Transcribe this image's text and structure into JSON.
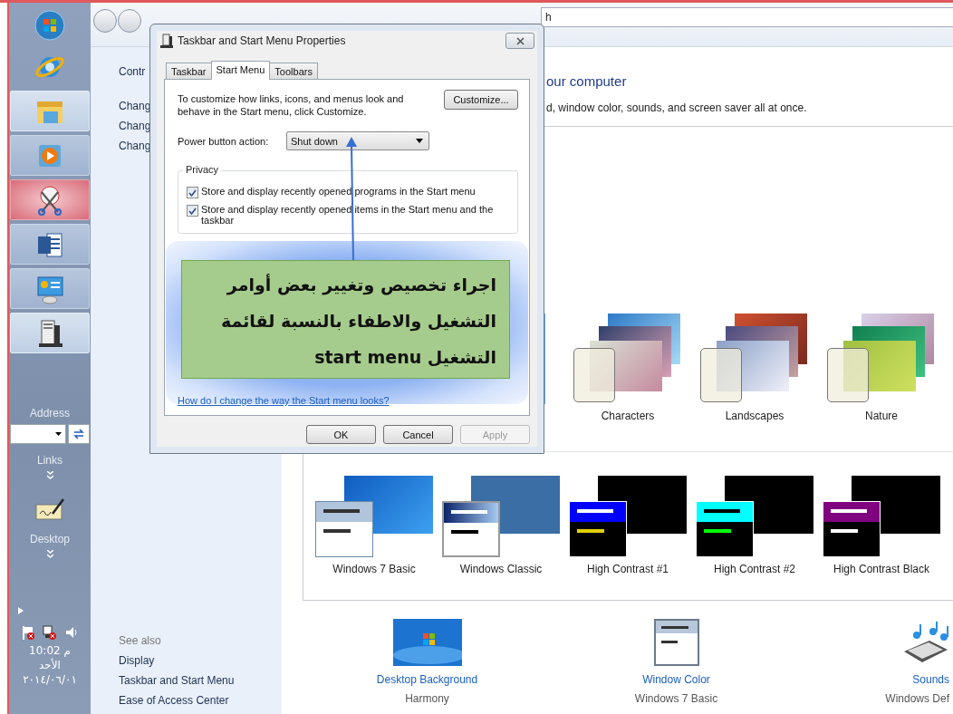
{
  "taskbar": {
    "buttons": [
      {
        "kind": "browser",
        "running": false,
        "highlighted": false,
        "attention": false
      },
      {
        "kind": "folder",
        "running": true,
        "highlighted": true,
        "attention": false
      },
      {
        "kind": "media",
        "running": true,
        "highlighted": false,
        "attention": false
      },
      {
        "kind": "scissors",
        "running": true,
        "highlighted": false,
        "attention": true
      },
      {
        "kind": "document",
        "running": true,
        "highlighted": false,
        "attention": false
      },
      {
        "kind": "presentation",
        "running": true,
        "highlighted": false,
        "attention": false
      },
      {
        "kind": "computer",
        "running": true,
        "highlighted": true,
        "attention": false
      }
    ],
    "address_toolbar": {
      "label": "Address"
    },
    "links_toolbar": {
      "label": "Links"
    },
    "desktop_toolbar": {
      "label": "Desktop"
    },
    "clock": {
      "time": "10:02 م",
      "day": "الأحد",
      "date": "٢٠١٤/٠٦/٠١"
    }
  },
  "control_panel": {
    "address_text": "h",
    "sidebar": {
      "title": "Contr",
      "links": [
        "Chang",
        "Chang",
        "Chang"
      ],
      "see_also": {
        "title": "See also",
        "links": [
          "Display",
          "Taskbar and Start Menu",
          "Ease of Access Center"
        ]
      }
    },
    "heading": "our computer",
    "description": "d, window color, sounds, and screen saver all at once.",
    "aero_themes": [
      {
        "label": "Characters"
      },
      {
        "label": "Landscapes"
      },
      {
        "label": "Nature"
      }
    ],
    "basic_themes": [
      {
        "label": "Windows 7 Basic",
        "kind": "basic"
      },
      {
        "label": "Windows Classic",
        "kind": "classic"
      },
      {
        "label": "High Contrast #1",
        "kind": "contrast1"
      },
      {
        "label": "High Contrast #2",
        "kind": "contrast2"
      },
      {
        "label": "High Contrast Black",
        "kind": "contrastblack"
      }
    ],
    "settings": [
      {
        "label": "Desktop Background",
        "value": "Harmony",
        "kind": "background"
      },
      {
        "label": "Window Color",
        "value": "Windows 7 Basic",
        "kind": "color"
      },
      {
        "label": "Sounds",
        "value": "Windows Def",
        "kind": "sounds"
      }
    ]
  },
  "dialog": {
    "title": "Taskbar and Start Menu Properties",
    "tabs": [
      {
        "label": "Taskbar",
        "selected": false
      },
      {
        "label": "Start Menu",
        "selected": true
      },
      {
        "label": "Toolbars",
        "selected": false
      }
    ],
    "intro": "To customize how links, icons, and menus look and behave in the Start menu, click Customize.",
    "customize_button": "Customize...",
    "power_label": "Power button action:",
    "power_value": "Shut down",
    "privacy": {
      "title": "Privacy",
      "options": [
        {
          "label": "Store and display recently opened programs in the Start menu",
          "checked": true
        },
        {
          "label": "Store and display recently opened items in the Start menu and the taskbar",
          "checked": true
        }
      ]
    },
    "help_link": "How do I change the way the Start menu looks?",
    "buttons": [
      {
        "label": "OK",
        "disabled": false
      },
      {
        "label": "Cancel",
        "disabled": false
      },
      {
        "label": "Apply",
        "disabled": true
      }
    ]
  },
  "callout": {
    "text": "اجراء تخصيص وتغيير بعض أوامر التشغيل والاطفاء بالنسبة لقائمة التشغيل start menu"
  }
}
